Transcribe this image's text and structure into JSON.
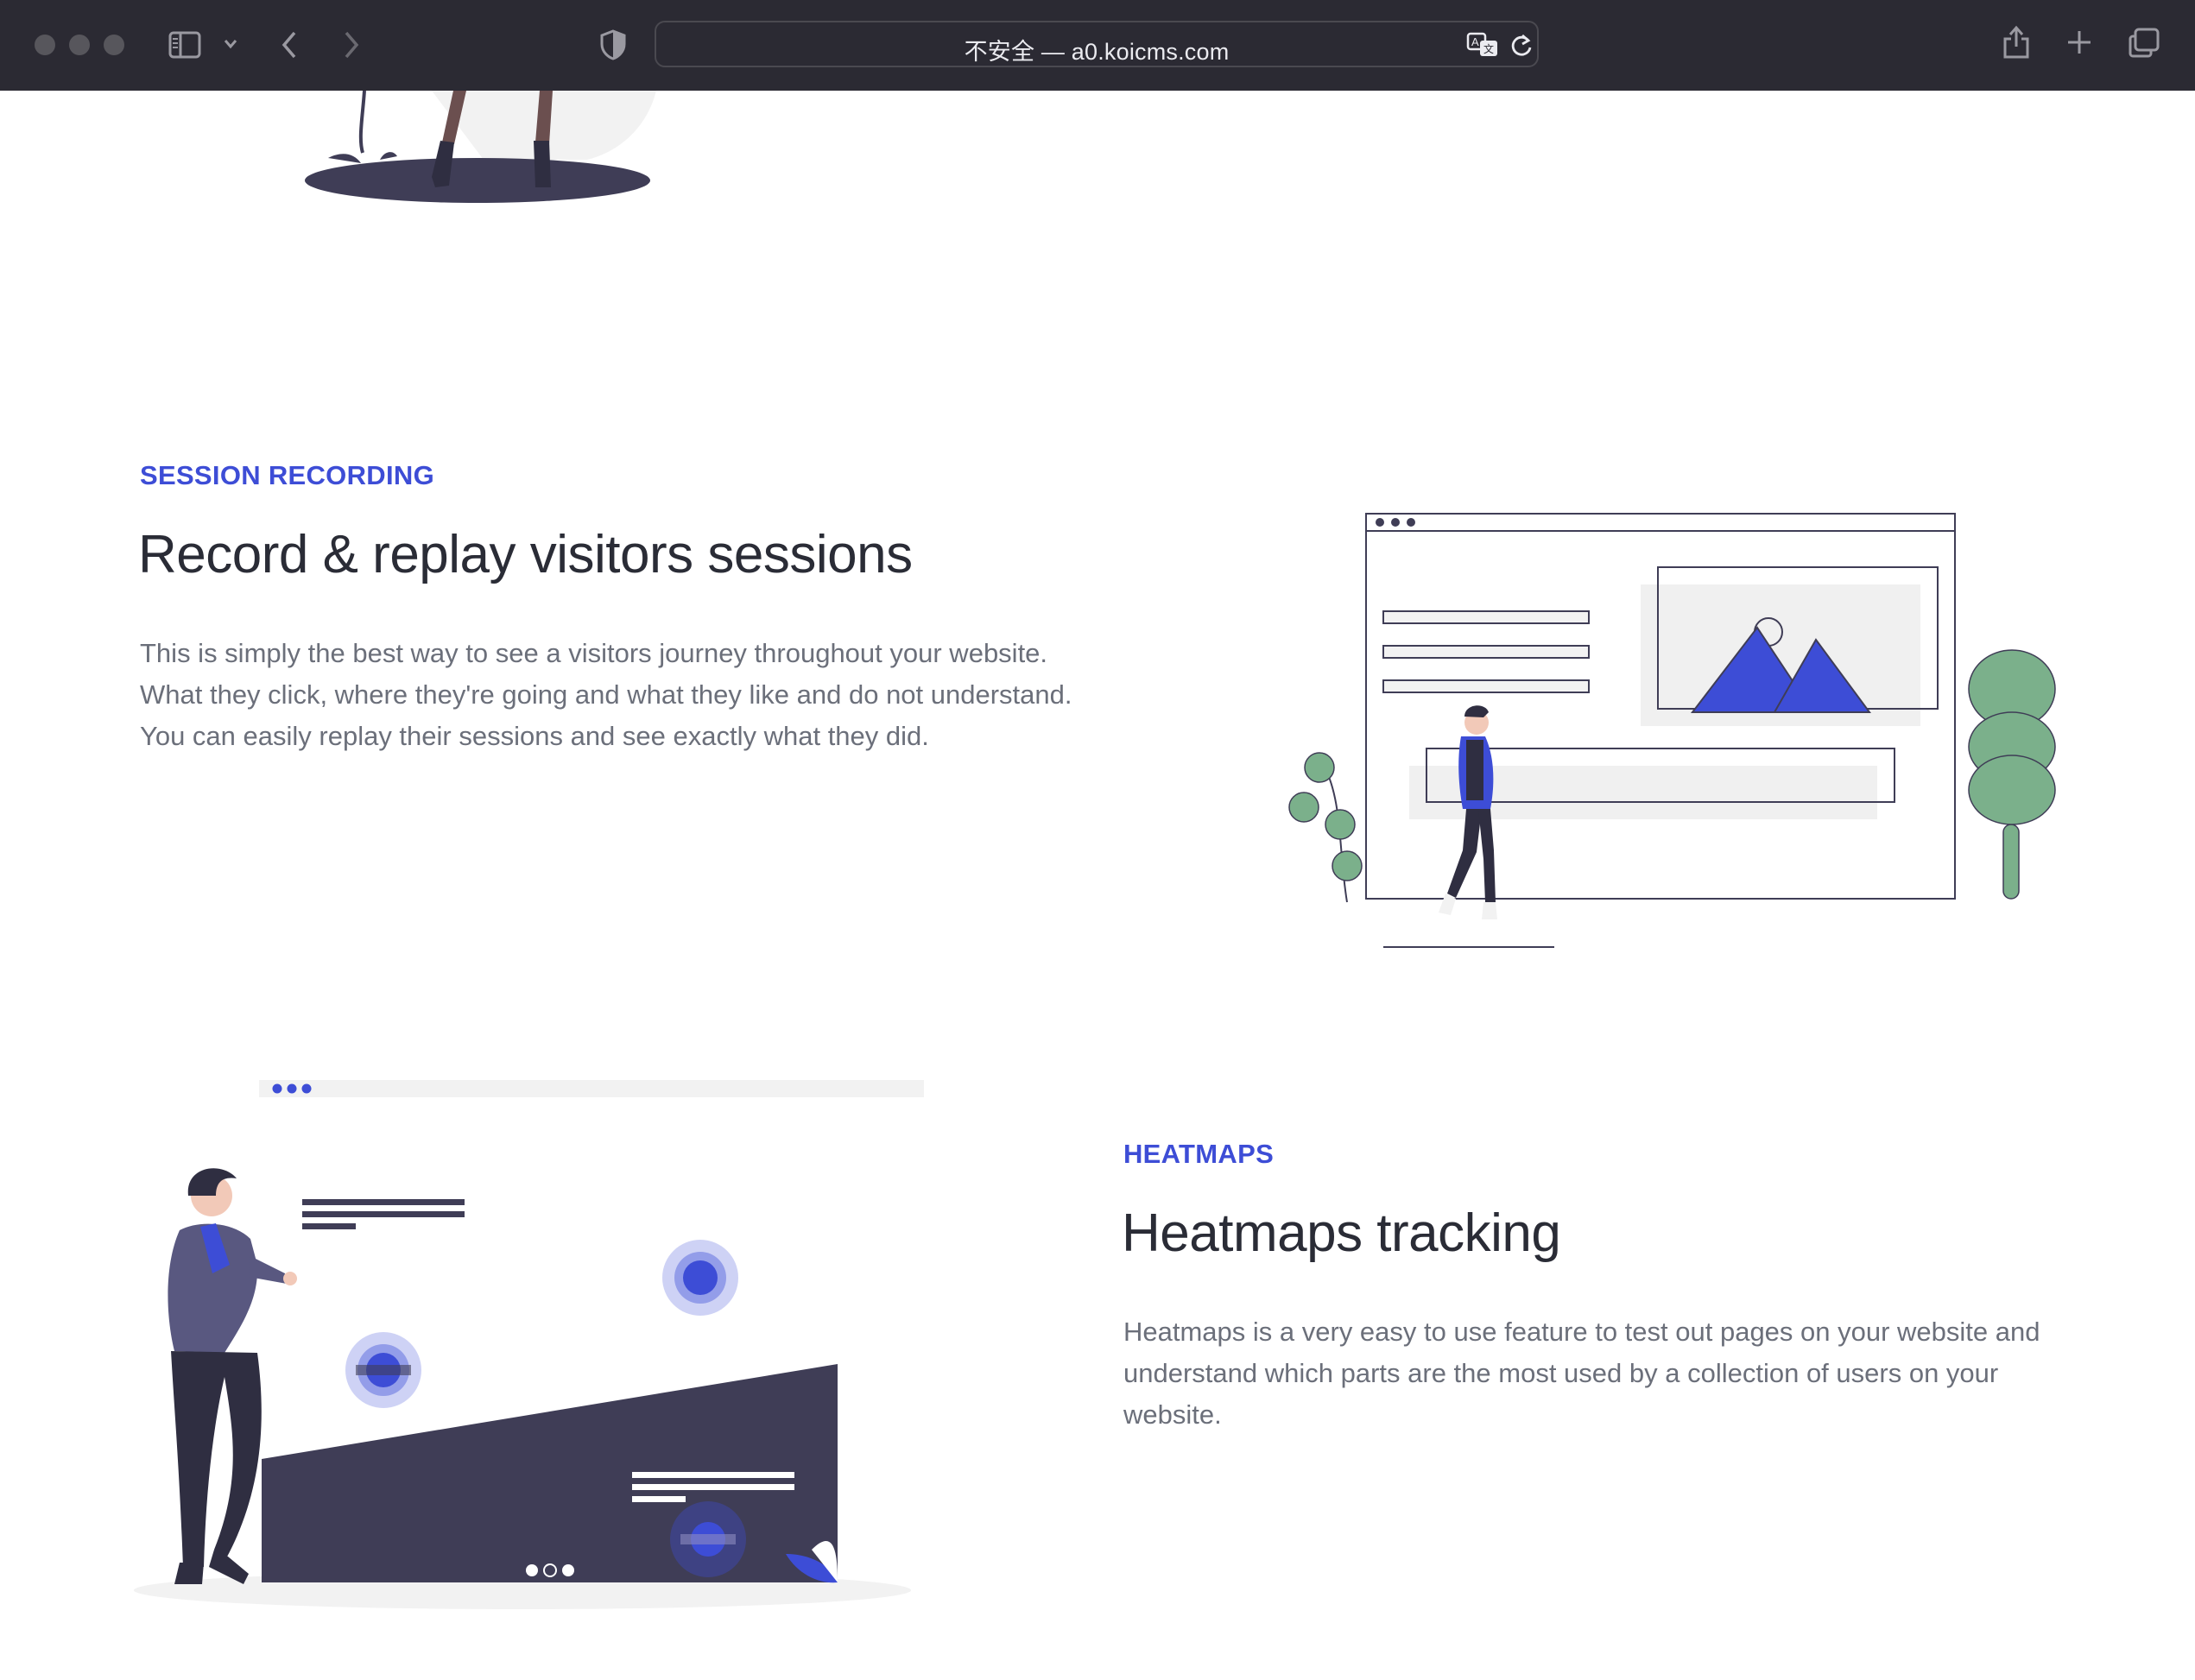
{
  "browser": {
    "address": "不安全 — a0.koicms.com",
    "icons": {
      "sidebar": "sidebar-icon",
      "back": "chevron-left-icon",
      "forward": "chevron-right-icon",
      "privacy": "shield-icon",
      "translate": "translate-icon",
      "reload": "reload-icon",
      "share": "share-icon",
      "new_tab": "plus-icon",
      "tabs": "tabs-overview-icon"
    }
  },
  "sections": {
    "session": {
      "eyebrow": "SESSION RECORDING",
      "title": "Record & replay visitors sessions",
      "body": "This is simply the best way to see a visitors journey throughout your website. What they click, where they're going and what they like and do not understand. You can easily replay their sessions and see exactly what they did."
    },
    "heatmaps": {
      "eyebrow": "HEATMAPS",
      "title": "Heatmaps tracking",
      "body": "Heatmaps is a very easy to use feature to test out pages on your website and understand which parts are the most used by a collection of users on your website."
    }
  },
  "colors": {
    "accent": "#3d4dd6",
    "heading": "#2a2c36",
    "body": "#6b6f7a",
    "illustration_dark": "#3f3d56",
    "illustration_green": "#7bb08b"
  }
}
